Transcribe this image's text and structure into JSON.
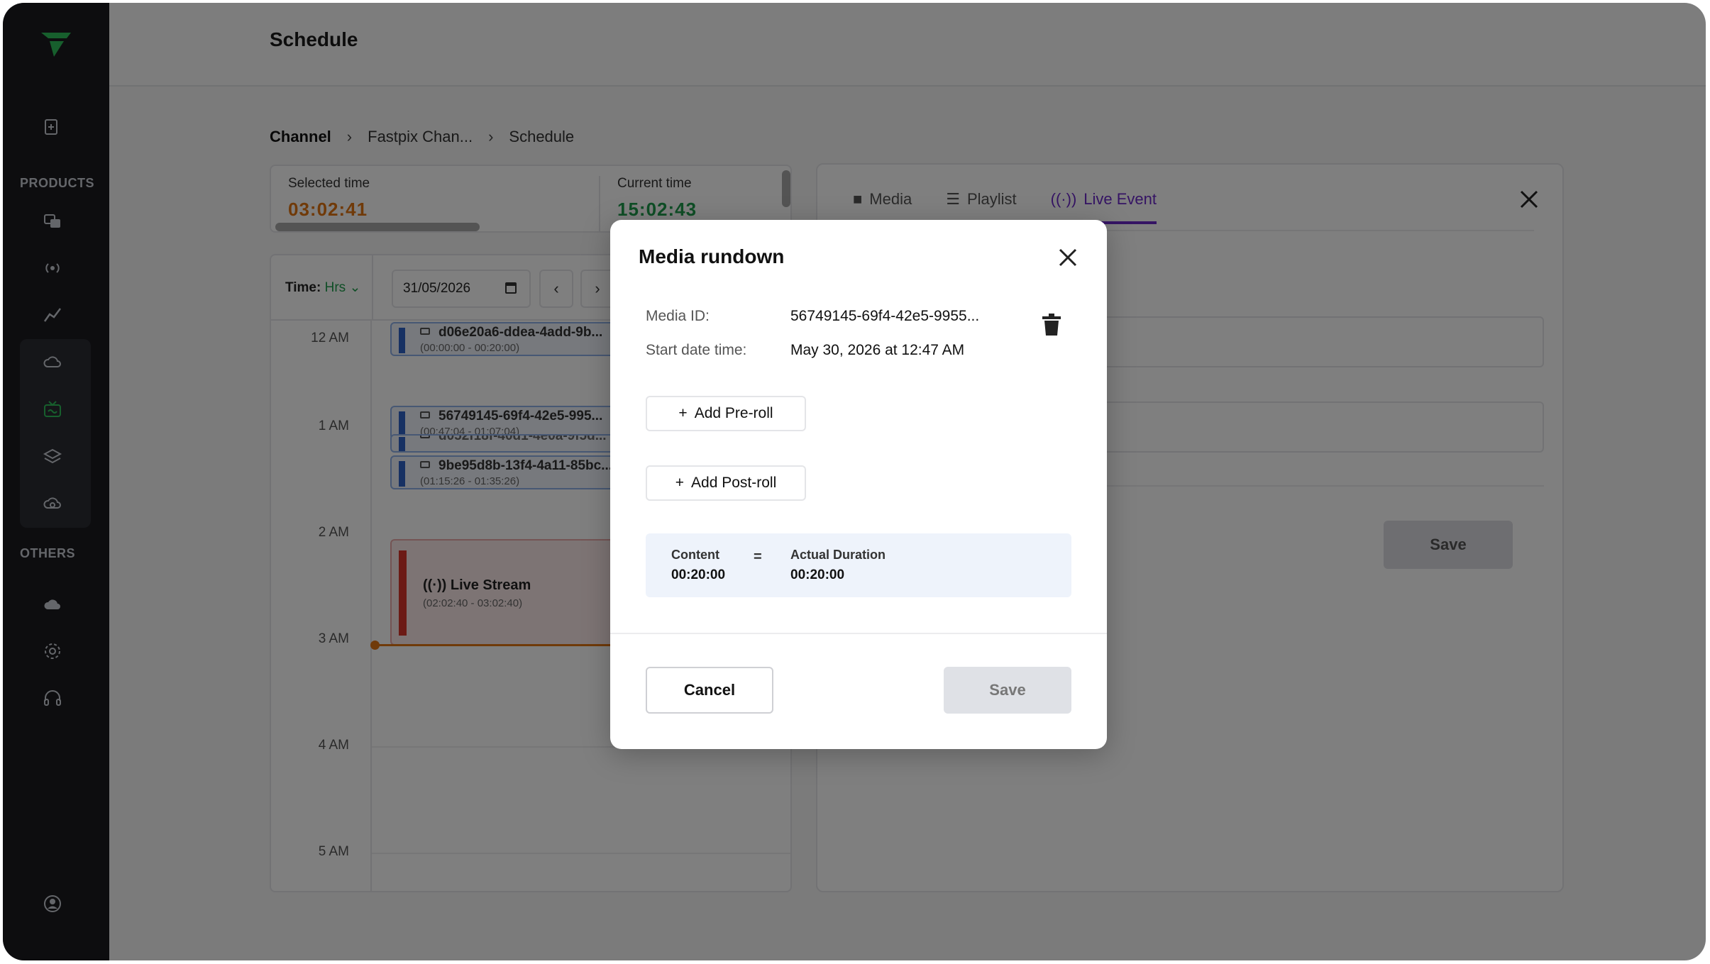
{
  "app": {
    "title": "Schedule"
  },
  "sidebar": {
    "products_label": "PRODUCTS",
    "others_label": "OTHERS",
    "accent": "#2fbf5b"
  },
  "breadcrumb": {
    "items": [
      "Channel",
      "Fastpix Chan...",
      "Schedule"
    ],
    "separator": "›"
  },
  "time_cards": {
    "selected_label": "Selected time",
    "selected_value": "03:02:41",
    "current_label": "Current time",
    "current_value": "15:02:43"
  },
  "schedule": {
    "time_label": "Time:",
    "time_unit": "Hrs",
    "date": "31/05/2026",
    "prev": "‹",
    "next": "›",
    "hours": [
      "12 AM",
      "1 AM",
      "2 AM",
      "3 AM",
      "4 AM",
      "5 AM"
    ],
    "events": [
      {
        "title": "d06e20a6-ddea-4add-9b...",
        "range": "(00:00:00 - 00:20:00)"
      },
      {
        "title": "56749145-69f4-42e5-995...",
        "range": "(00:47:04 - 01:07:04)"
      },
      {
        "title": "d052f18f-40d1-4e0a-9f5d...",
        "range": ""
      },
      {
        "title": "9be95d8b-13f4-4a11-85bc...",
        "range": "(01:15:26 - 01:35:26)"
      }
    ],
    "live": {
      "title": "Live Stream",
      "range": "(02:02:40 - 03:02:40)"
    }
  },
  "right_panel": {
    "tabs": [
      {
        "label": "Media",
        "icon": "video-icon"
      },
      {
        "label": "Playlist",
        "icon": "list-icon"
      },
      {
        "label": "Live Event",
        "icon": "broadcast-icon"
      }
    ],
    "save_label": "Save"
  },
  "modal": {
    "title": "Media rundown",
    "media_id_label": "Media ID:",
    "media_id_value": "56749145-69f4-42e5-9955...",
    "start_label": "Start date time:",
    "start_value": "May 30, 2026 at 12:47 AM",
    "add_preroll": "Add Pre-roll",
    "add_postroll": "Add Post-roll",
    "plus": "+",
    "content_label": "Content",
    "content_value": "00:20:00",
    "equals": "=",
    "actual_label": "Actual Duration",
    "actual_value": "00:20:00",
    "cancel_label": "Cancel",
    "save_label": "Save"
  }
}
